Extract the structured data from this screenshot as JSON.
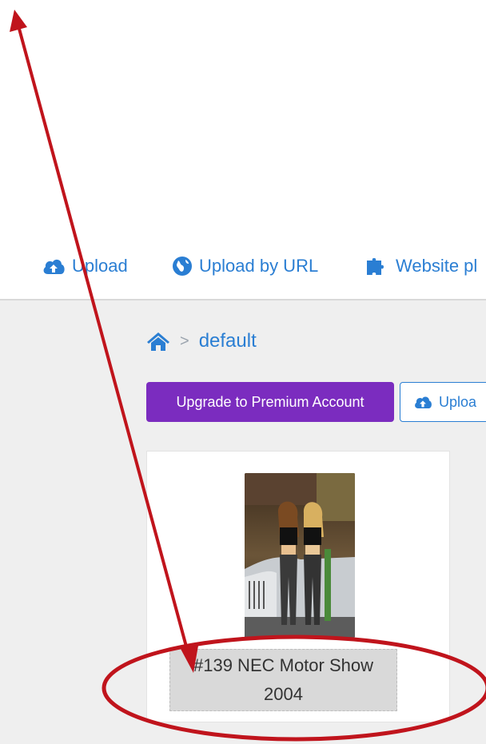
{
  "nav": {
    "upload_label": "Upload",
    "upload_url_label": "Upload by URL",
    "website_plugin_label": "Website pl"
  },
  "breadcrumb": {
    "home_icon": "home-icon",
    "separator": ">",
    "current": "default"
  },
  "buttons": {
    "premium_label": "Upgrade to Premium Account",
    "upload_label": "Uploa"
  },
  "gallery": {
    "items": [
      {
        "title_line1": "#139 NEC Motor Show",
        "title_line2": "2004"
      }
    ]
  },
  "colors": {
    "link": "#2a7ed3",
    "premium": "#7b2cbf",
    "annotation": "#c0141c"
  },
  "icons": [
    "cloud-upload-icon",
    "globe-icon",
    "puzzle-icon",
    "home-icon",
    "chevron-right-icon",
    "arrow-annotation",
    "ellipse-annotation"
  ]
}
